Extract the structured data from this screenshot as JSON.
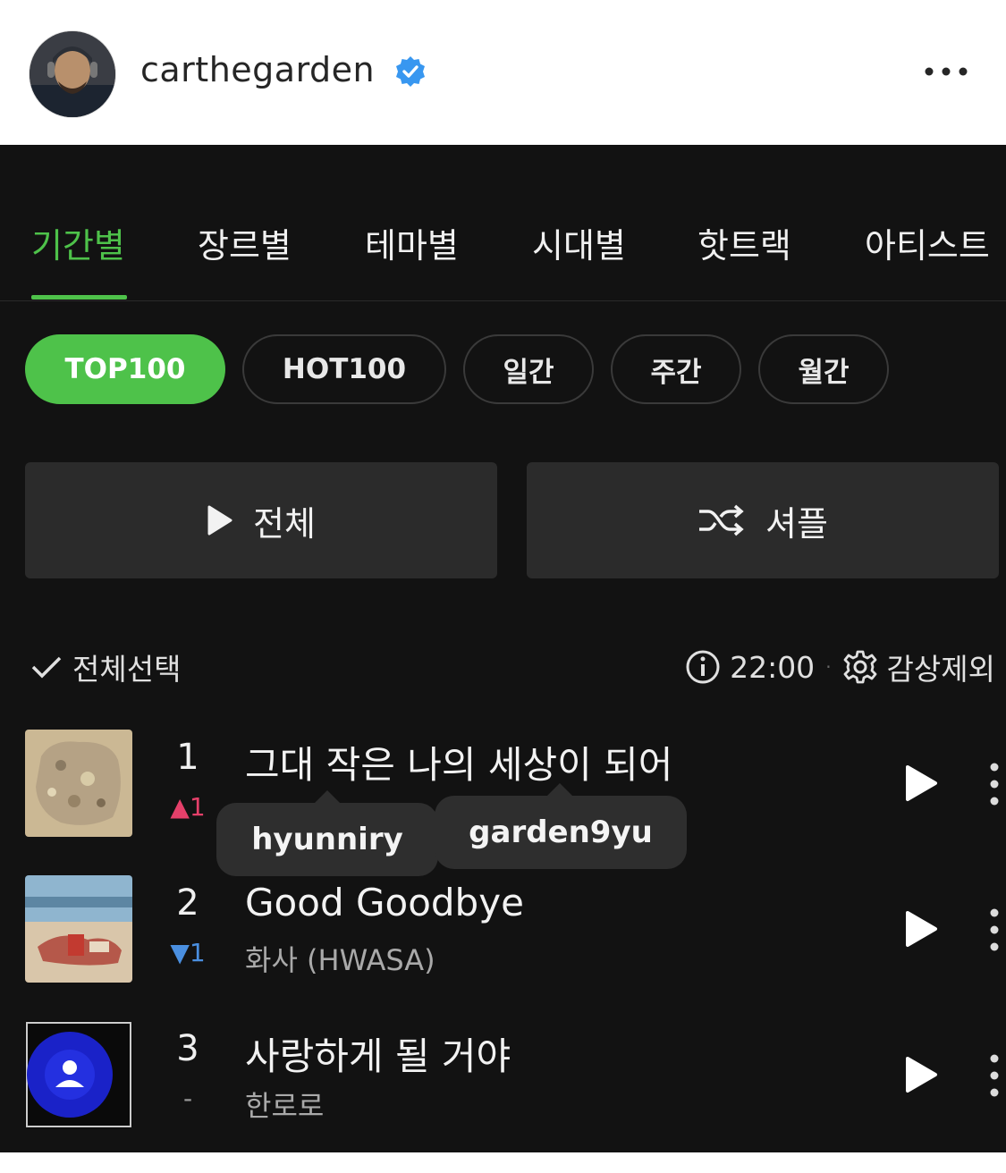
{
  "post": {
    "username": "carthegarden",
    "verified": true,
    "more_icon": "ellipsis-icon"
  },
  "chart": {
    "tabs": [
      "기간별",
      "장르별",
      "테마별",
      "시대별",
      "핫트랙",
      "아티스트"
    ],
    "active_tab": "기간별",
    "chips": [
      "TOP100",
      "HOT100",
      "일간",
      "주간",
      "월간"
    ],
    "active_chip": "TOP100",
    "play_all_label": "전체",
    "shuffle_label": "셔플",
    "select_all_label": "전체선택",
    "time": "22:00",
    "exclude_label": "감상제외",
    "accent_color": "#4ec24a"
  },
  "songs": [
    {
      "rank": "1",
      "change": "▲1",
      "change_dir": "up",
      "title": "그대 작은 나의 세상이 되어",
      "artist": ""
    },
    {
      "rank": "2",
      "change": "▼1",
      "change_dir": "down",
      "title": "Good Goodbye",
      "artist": "화사 (HWASA)"
    },
    {
      "rank": "3",
      "change": "-",
      "change_dir": "same",
      "title": "사랑하게 될 거야",
      "artist": "한로로"
    }
  ],
  "tags": [
    "hyunniry",
    "garden9yu"
  ]
}
